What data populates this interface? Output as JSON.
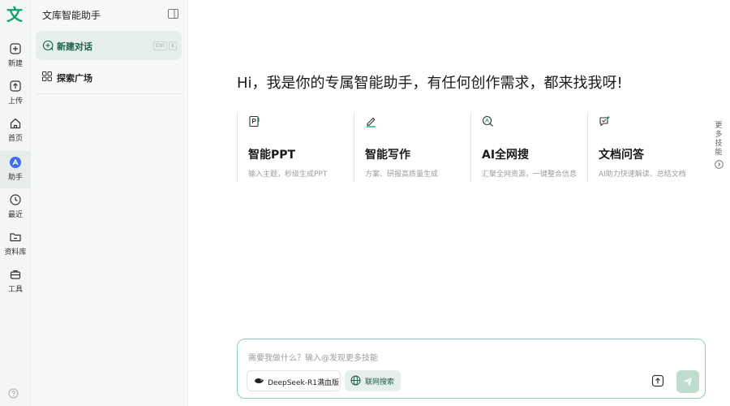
{
  "app": {
    "logo_char": "文",
    "title": "文库智能助手"
  },
  "rail": {
    "items": [
      {
        "id": "new",
        "label": "新建",
        "icon": "plus-icon"
      },
      {
        "id": "upload",
        "label": "上传",
        "icon": "upload-icon"
      },
      {
        "id": "home",
        "label": "首页",
        "icon": "home-icon"
      },
      {
        "id": "assistant",
        "label": "助手",
        "icon": "assistant-icon",
        "active": true
      },
      {
        "id": "recent",
        "label": "最近",
        "icon": "clock-icon"
      },
      {
        "id": "library",
        "label": "资料库",
        "icon": "folder-icon"
      },
      {
        "id": "tools",
        "label": "工具",
        "icon": "toolbox-icon"
      }
    ],
    "help_icon": "help-icon"
  },
  "sidebar": {
    "new_chat": {
      "label": "新建对话",
      "shortcut": [
        "Ctrl",
        "K"
      ]
    },
    "explore": {
      "label": "探索广场"
    }
  },
  "main": {
    "greeting": "Hi，我是你的专属智能助手，有任何创作需求，都来找我呀!",
    "cards": [
      {
        "title": "智能PPT",
        "subtitle": "输入主题，秒级生成PPT",
        "icon": "ppt-icon"
      },
      {
        "title": "智能写作",
        "subtitle": "方案、研报高质量生成",
        "icon": "pen-icon"
      },
      {
        "title": "AI全网搜",
        "subtitle": "汇聚全网资源，一键整合信息",
        "icon": "search-icon"
      },
      {
        "title": "文档问答",
        "subtitle": "AI助力快速解读、总结文档",
        "icon": "chat-doc-icon"
      }
    ],
    "more_skills": "更多技能"
  },
  "composer": {
    "placeholder": "需要我做什么？输入@发现更多技能",
    "model_label": "DeepSeek-R1满血版",
    "web_search_label": "联网搜索"
  },
  "colors": {
    "accent": "#11a36a",
    "accent_dark": "#1b5e47",
    "accent_bg": "#e6efeb",
    "composer_border": "#8fd1b4"
  }
}
